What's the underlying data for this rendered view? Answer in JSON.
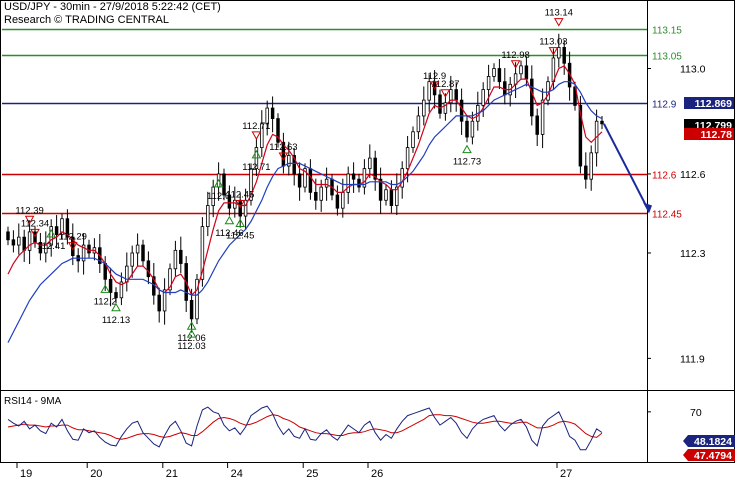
{
  "header": {
    "title": "USD/JPY - 30min - 27/9/2018 5:22:42 (CET)",
    "source": "Research © TRADING CENTRAL"
  },
  "colors": {
    "candle": "#000000",
    "ma_fast": "#d0021b",
    "ma_slow": "#1f3fbf",
    "resistance_green": "#2e8b2e",
    "pivot_blue": "#1a237e",
    "support_red": "#cc0000",
    "forecast_arrow": "#1a2a9a",
    "rsi_line": "#1a237e",
    "rsi_ma": "#cc0000"
  },
  "chart_data": [
    {
      "type": "line",
      "panel": "price",
      "series": [
        {
          "name": "USD/JPY",
          "style": "candlestick",
          "close": [
            112.35,
            112.33,
            112.36,
            112.31,
            112.38,
            112.34,
            112.3,
            112.33,
            112.4,
            112.37,
            112.43,
            112.36,
            112.29,
            112.27,
            112.33,
            112.3,
            112.32,
            112.26,
            112.2,
            112.15,
            112.13,
            112.19,
            112.25,
            112.3,
            112.33,
            112.27,
            112.21,
            112.14,
            112.08,
            112.16,
            112.24,
            112.31,
            112.26,
            112.12,
            112.05,
            112.2,
            112.4,
            112.48,
            112.55,
            112.6,
            112.52,
            112.47,
            112.5,
            112.44,
            112.5,
            112.62,
            112.7,
            112.79,
            112.85,
            112.81,
            112.72,
            112.63,
            112.67,
            112.6,
            112.55,
            112.62,
            112.53,
            112.5,
            112.55,
            112.58,
            112.52,
            112.47,
            112.53,
            112.6,
            112.58,
            112.55,
            112.62,
            112.66,
            112.58,
            112.5,
            112.54,
            112.48,
            112.55,
            112.62,
            112.7,
            112.76,
            112.82,
            112.88,
            112.95,
            112.9,
            112.83,
            112.87,
            112.92,
            112.88,
            112.8,
            112.74,
            112.8,
            112.86,
            112.92,
            112.97,
            113.0,
            112.95,
            112.9,
            112.94,
            112.98,
            113.01,
            112.96,
            112.82,
            112.75,
            112.88,
            112.95,
            113.04,
            113.08,
            113.02,
            112.93,
            112.86,
            112.63,
            112.58,
            112.68,
            112.8,
            112.79
          ],
          "annotations": {
            "swing_highs": [
              112.39,
              112.45,
              112.34,
              112.29,
              112.87,
              112.63,
              112.71,
              112.98,
              113.03,
              113.14,
              112.9
            ],
            "swing_lows": [
              112.2,
              112.13,
              112.06,
              112.03,
              112.46,
              112.45,
              112.41,
              112.71,
              112.73,
              112.6
            ]
          }
        },
        {
          "name": "",
          "style": "moving-average-fast",
          "values": [
            112.22,
            112.26,
            112.29,
            112.31,
            112.33,
            112.34,
            112.33,
            112.33,
            112.35,
            112.36,
            112.38,
            112.37,
            112.35,
            112.33,
            112.32,
            112.31,
            112.31,
            112.29,
            112.26,
            112.22,
            112.19,
            112.18,
            112.19,
            112.22,
            112.25,
            112.25,
            112.23,
            112.2,
            112.16,
            112.15,
            112.17,
            112.21,
            112.22,
            112.19,
            112.14,
            112.16,
            112.23,
            112.31,
            112.39,
            112.46,
            112.49,
            112.49,
            112.49,
            112.48,
            112.48,
            112.52,
            112.57,
            112.64,
            112.71,
            112.75,
            112.74,
            112.71,
            112.69,
            112.66,
            112.62,
            112.61,
            112.59,
            112.56,
            112.56,
            112.56,
            112.55,
            112.53,
            112.53,
            112.55,
            112.56,
            112.56,
            112.57,
            112.6,
            112.59,
            112.57,
            112.56,
            112.54,
            112.54,
            112.57,
            112.61,
            112.66,
            112.71,
            112.77,
            112.83,
            112.86,
            112.85,
            112.86,
            112.88,
            112.88,
            112.85,
            112.82,
            112.81,
            112.82,
            112.85,
            112.89,
            112.93,
            112.93,
            112.92,
            112.92,
            112.94,
            112.96,
            112.96,
            112.91,
            112.86,
            112.87,
            112.9,
            112.95,
            113.0,
            113.01,
            112.98,
            112.94,
            112.83,
            112.74,
            112.72,
            112.74,
            112.76
          ]
        },
        {
          "name": "",
          "style": "moving-average-slow",
          "values": [
            111.96,
            112.0,
            112.04,
            112.08,
            112.12,
            112.15,
            112.18,
            112.2,
            112.22,
            112.24,
            112.26,
            112.27,
            112.28,
            112.28,
            112.28,
            112.28,
            112.28,
            112.27,
            112.26,
            112.24,
            112.22,
            112.21,
            112.2,
            112.2,
            112.2,
            112.2,
            112.19,
            112.18,
            112.16,
            112.15,
            112.15,
            112.15,
            112.16,
            112.15,
            112.14,
            112.14,
            112.16,
            112.19,
            112.23,
            112.27,
            112.3,
            112.33,
            112.35,
            112.37,
            112.39,
            112.42,
            112.46,
            112.5,
            112.55,
            112.59,
            112.62,
            112.63,
            112.64,
            112.64,
            112.64,
            112.63,
            112.62,
            112.61,
            112.6,
            112.59,
            112.58,
            112.57,
            112.56,
            112.56,
            112.56,
            112.56,
            112.56,
            112.57,
            112.57,
            112.57,
            112.57,
            112.56,
            112.56,
            112.57,
            112.59,
            112.61,
            112.64,
            112.67,
            112.71,
            112.74,
            112.76,
            112.78,
            112.8,
            112.82,
            112.82,
            112.82,
            112.82,
            112.83,
            112.84,
            112.86,
            112.88,
            112.89,
            112.9,
            112.91,
            112.92,
            112.93,
            112.94,
            112.93,
            112.92,
            112.91,
            112.91,
            112.92,
            112.94,
            112.95,
            112.95,
            112.94,
            112.91,
            112.87,
            112.84,
            112.82,
            112.81
          ]
        }
      ],
      "levels": [
        {
          "label": "113.15",
          "value": 113.15,
          "color": "#2e8b2e"
        },
        {
          "label": "113.05",
          "value": 113.05,
          "color": "#2e8b2e"
        },
        {
          "label": "112.9",
          "value": 112.869,
          "color": "#1a237e"
        },
        {
          "label": "112.6",
          "value": 112.6,
          "color": "#cc0000"
        },
        {
          "label": "112.45",
          "value": 112.45,
          "color": "#cc0000"
        }
      ],
      "price_tags": [
        {
          "label": "112.869",
          "value": 112.869,
          "bg": "#1a237e",
          "fg": "#ffffff"
        },
        {
          "label": "112.799",
          "value": 112.799,
          "bg": "#000000",
          "fg": "#ffffff"
        },
        {
          "label": "112.78",
          "value": 112.78,
          "bg": "#cc0000",
          "fg": "#ffffff"
        }
      ],
      "forecast": {
        "from": 112.79,
        "to": 112.45
      },
      "y_ticks": [
        "113.0",
        "112.6",
        "112.3",
        "111.9"
      ],
      "y_tick_values": [
        113.0,
        112.6,
        112.3,
        111.9
      ],
      "ylim": [
        111.78,
        113.26
      ]
    },
    {
      "type": "line",
      "panel": "rsi",
      "title": "RSI14 - 9MA",
      "series": [
        {
          "name": "RSI14",
          "values": [
            62,
            58,
            55,
            60,
            52,
            56,
            50,
            47,
            58,
            54,
            62,
            50,
            41,
            40,
            52,
            48,
            50,
            43,
            38,
            35,
            34,
            44,
            52,
            58,
            60,
            48,
            42,
            36,
            33,
            45,
            55,
            60,
            50,
            37,
            34,
            55,
            72,
            75,
            70,
            68,
            56,
            50,
            53,
            46,
            54,
            66,
            70,
            74,
            76,
            68,
            55,
            46,
            52,
            44,
            42,
            52,
            41,
            40,
            47,
            51,
            44,
            40,
            48,
            56,
            52,
            48,
            56,
            60,
            48,
            40,
            46,
            42,
            52,
            60,
            66,
            68,
            70,
            72,
            74,
            64,
            56,
            60,
            64,
            58,
            48,
            42,
            52,
            58,
            62,
            64,
            66,
            56,
            50,
            56,
            60,
            62,
            54,
            40,
            34,
            55,
            62,
            66,
            70,
            58,
            44,
            40,
            30,
            30,
            40,
            52,
            48.18
          ]
        },
        {
          "name": "9MA",
          "values": [
            54,
            55,
            56,
            57,
            56,
            56,
            55,
            54,
            55,
            55,
            56,
            56,
            53,
            51,
            51,
            50,
            49,
            48,
            47,
            45,
            42,
            41,
            42,
            44,
            46,
            47,
            47,
            46,
            44,
            43,
            44,
            46,
            48,
            47,
            45,
            45,
            49,
            54,
            59,
            63,
            64,
            63,
            61,
            58,
            56,
            57,
            59,
            62,
            65,
            67,
            66,
            63,
            61,
            58,
            54,
            52,
            50,
            48,
            47,
            47,
            46,
            45,
            45,
            47,
            48,
            48,
            49,
            51,
            52,
            51,
            50,
            48,
            48,
            50,
            53,
            56,
            59,
            62,
            66,
            67,
            67,
            66,
            66,
            65,
            63,
            61,
            59,
            58,
            58,
            59,
            60,
            60,
            59,
            58,
            58,
            59,
            59,
            56,
            53,
            53,
            54,
            56,
            59,
            60,
            59,
            57,
            52,
            47,
            44,
            43,
            47.48
          ]
        }
      ],
      "y_ticks": [
        "70"
      ],
      "y_tick_values": [
        70
      ],
      "ylim": [
        17,
        92
      ],
      "value_tags": [
        {
          "label": "48.1824",
          "bg": "#1a237e",
          "fg": "#ffffff"
        },
        {
          "label": "47.4794",
          "bg": "#cc0000",
          "fg": "#ffffff"
        }
      ],
      "x_ticks": [
        "19",
        "20",
        "21",
        "24",
        "25",
        "26",
        "27"
      ],
      "x_tick_positions": [
        5,
        18,
        32,
        44,
        58,
        70,
        105
      ]
    }
  ]
}
